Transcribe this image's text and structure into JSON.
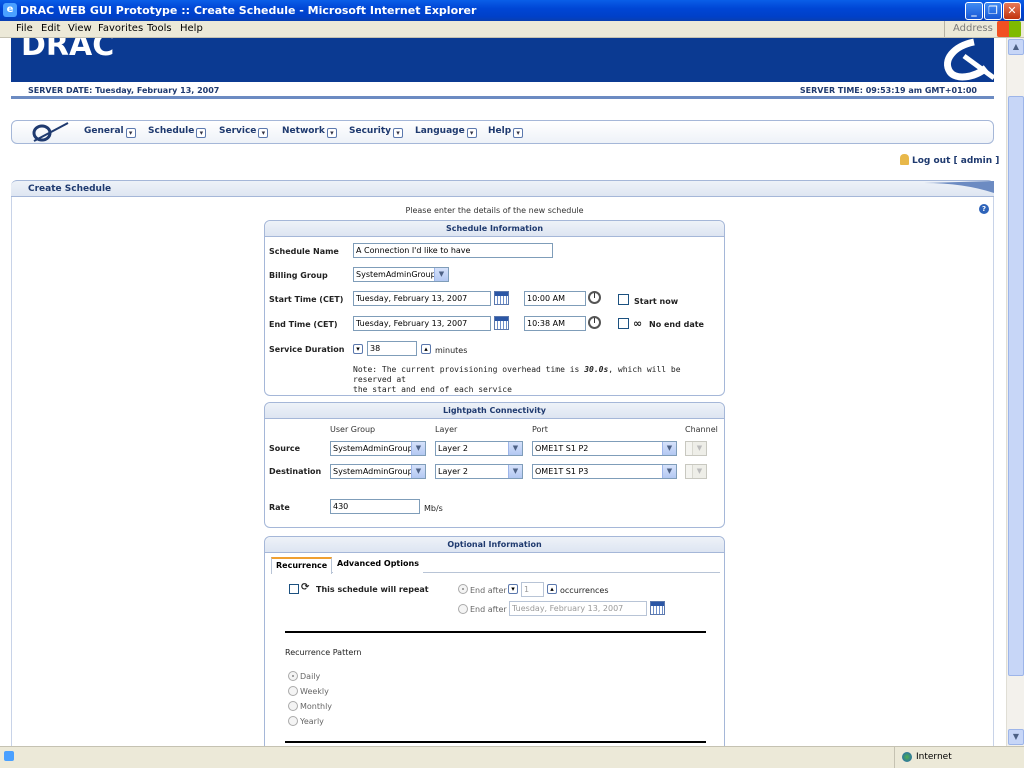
{
  "window": {
    "title": "DRAC WEB GUI Prototype :: Create Schedule - Microsoft Internet Explorer"
  },
  "menubar": {
    "items": [
      "File",
      "Edit",
      "View",
      "Favorites",
      "Tools",
      "Help"
    ],
    "address_label": "Address"
  },
  "banner": {
    "logo_text": "DRAC",
    "server_date": "SERVER DATE: Tuesday, February 13, 2007",
    "server_time": "SERVER TIME: 09:53:19 am GMT+01:00"
  },
  "nav": {
    "items": [
      "General",
      "Schedule",
      "Service",
      "Network",
      "Security",
      "Language",
      "Help"
    ]
  },
  "logout_label": "Log out [ admin ]",
  "page_title": "Create Schedule",
  "instruction": "Please enter the details of the new schedule",
  "schedule_info": {
    "title": "Schedule Information",
    "name_label": "Schedule Name",
    "name_value": "A Connection I'd like to have",
    "billing_label": "Billing Group",
    "billing_value": "SystemAdminGroup",
    "start_label": "Start Time (CET)",
    "start_date": "Tuesday, February 13, 2007",
    "start_time": "10:00 AM",
    "start_now_label": "Start now",
    "end_label": "End Time (CET)",
    "end_date": "Tuesday, February 13, 2007",
    "end_time": "10:38 AM",
    "no_end_label": "No end date",
    "no_end_symbol": "∞",
    "duration_label": "Service Duration",
    "duration_value": "38",
    "duration_unit": "minutes",
    "note_line1_pre": "Note: The current provisioning overhead time is ",
    "note_overhead": "30.0s",
    "note_line1_post": ", which will be reserved at",
    "note_line2": "the start and end of each service"
  },
  "lightpath": {
    "title": "Lightpath Connectivity",
    "col_user_group": "User Group",
    "col_layer": "Layer",
    "col_port": "Port",
    "col_channel": "Channel",
    "source_label": "Source",
    "source_group": "SystemAdminGroup",
    "source_layer": "Layer 2",
    "source_port": "OME1T S1 P2",
    "dest_label": "Destination",
    "dest_group": "SystemAdminGroup",
    "dest_layer": "Layer 2",
    "dest_port": "OME1T S1 P3",
    "rate_label": "Rate",
    "rate_value": "430",
    "rate_unit": "Mb/s"
  },
  "optional": {
    "title": "Optional Information",
    "tab_recurrence": "Recurrence",
    "tab_advanced": "Advanced Options",
    "repeat_label": "This schedule will repeat",
    "end_after_label": "End after",
    "occurrences_value": "1",
    "occurrences_label": "occurrences",
    "end_after2_label": "End after",
    "end_after_date": "Tuesday, February 13, 2007",
    "pattern_label": "Recurrence Pattern",
    "patterns": [
      "Daily",
      "Weekly",
      "Monthly",
      "Yearly"
    ]
  },
  "statusbar": {
    "zone": "Internet"
  },
  "colors": {
    "banner_blue": "#0b3a92",
    "nav_text": "#1f3a6f"
  }
}
